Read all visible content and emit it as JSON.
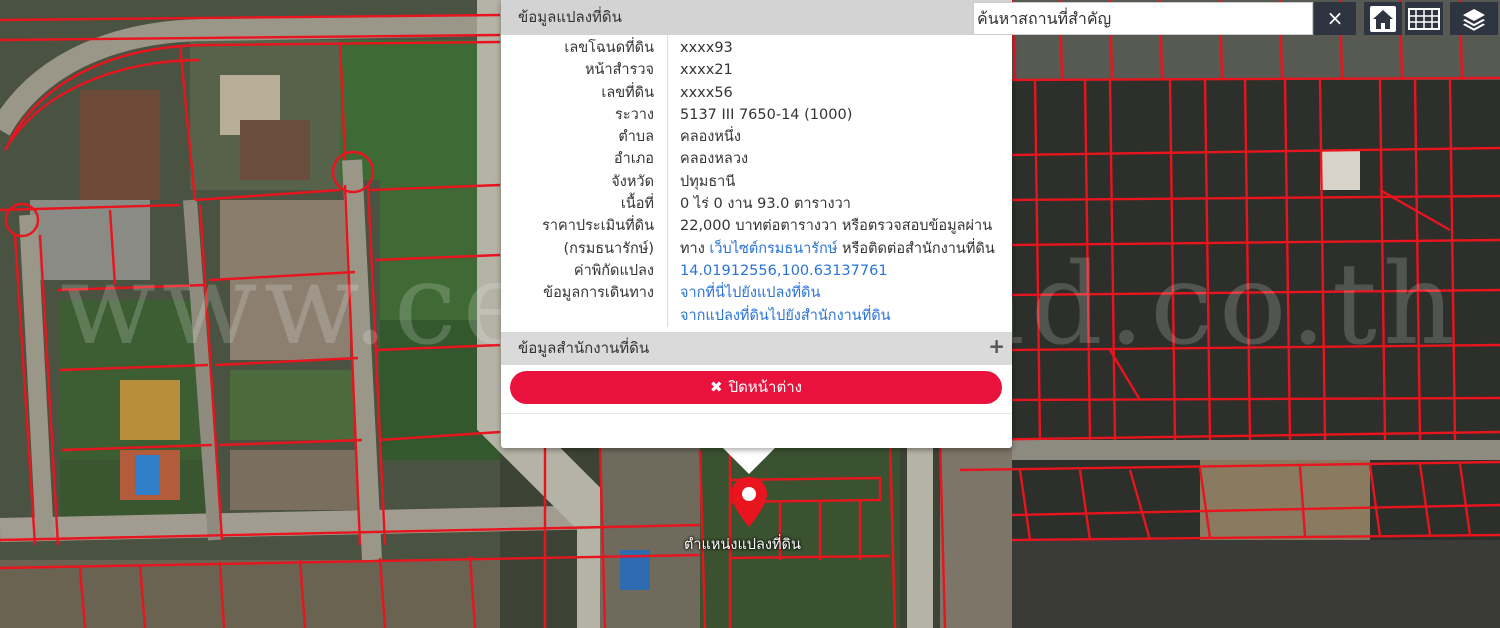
{
  "popup": {
    "title": "ข้อมูลแปลงที่ดิน",
    "rows": [
      {
        "label": "เลขโฉนดที่ดิน",
        "value": "xxxx93"
      },
      {
        "label": "หน้าสำรวจ",
        "value": "xxxx21"
      },
      {
        "label": "เลขที่ดิน",
        "value": "xxxx56"
      },
      {
        "label": "ระวาง",
        "value": "5137 III 7650-14 (1000)"
      },
      {
        "label": "ตำบล",
        "value": "คลองหนึ่ง"
      },
      {
        "label": "อำเภอ",
        "value": "คลองหลวง"
      },
      {
        "label": "จังหวัด",
        "value": "ปทุมธานี"
      },
      {
        "label": "เนื้อที่",
        "value": "0 ไร่ 0 งาน 93.0 ตารางวา"
      }
    ],
    "price": {
      "label_line1": "ราคาประเมินที่ดิน",
      "label_line2": "(กรมธนารักษ์)",
      "text_line1": "22,000 บาทต่อตารางวา หรือตรวจสอบข้อมูลผ่าน",
      "text_line2_prefix": "ทาง",
      "text_line2_link": "เว็บไซต์กรมธนารักษ์",
      "text_line2_suffix": "หรือติดต่อสำนักงานที่ดิน"
    },
    "coords": {
      "label": "ค่าพิกัดแปลง",
      "value": "14.01912556,100.63137761"
    },
    "directions": {
      "label": "ข้อมูลการเดินทาง",
      "link1": "จากที่นี่ไปยังแปลงที่ดิน",
      "link2": "จากแปลงที่ดินไปยังสำนักงานที่ดิน"
    },
    "office_section": {
      "label": "ข้อมูลสำนักงานที่ดิน",
      "expand_icon": "+"
    },
    "close_button": {
      "icon": "✖",
      "label": "ปิดหน้าต่าง"
    }
  },
  "search": {
    "value": "ค้นหาสถานที่สำคัญ",
    "clear_icon": "×"
  },
  "toolbar": {
    "icons": [
      "home-icon",
      "grid-icon",
      "layers-icon"
    ]
  },
  "marker": {
    "label": "ตำแหน่งแปลงที่ดิน"
  },
  "watermark": {
    "text": "www.centralland.co.th"
  },
  "colors": {
    "parcel_line": "#e8141e",
    "close_button": "#e8123c",
    "link": "#2a73d9",
    "toolbar_bg": "#2e3440"
  }
}
